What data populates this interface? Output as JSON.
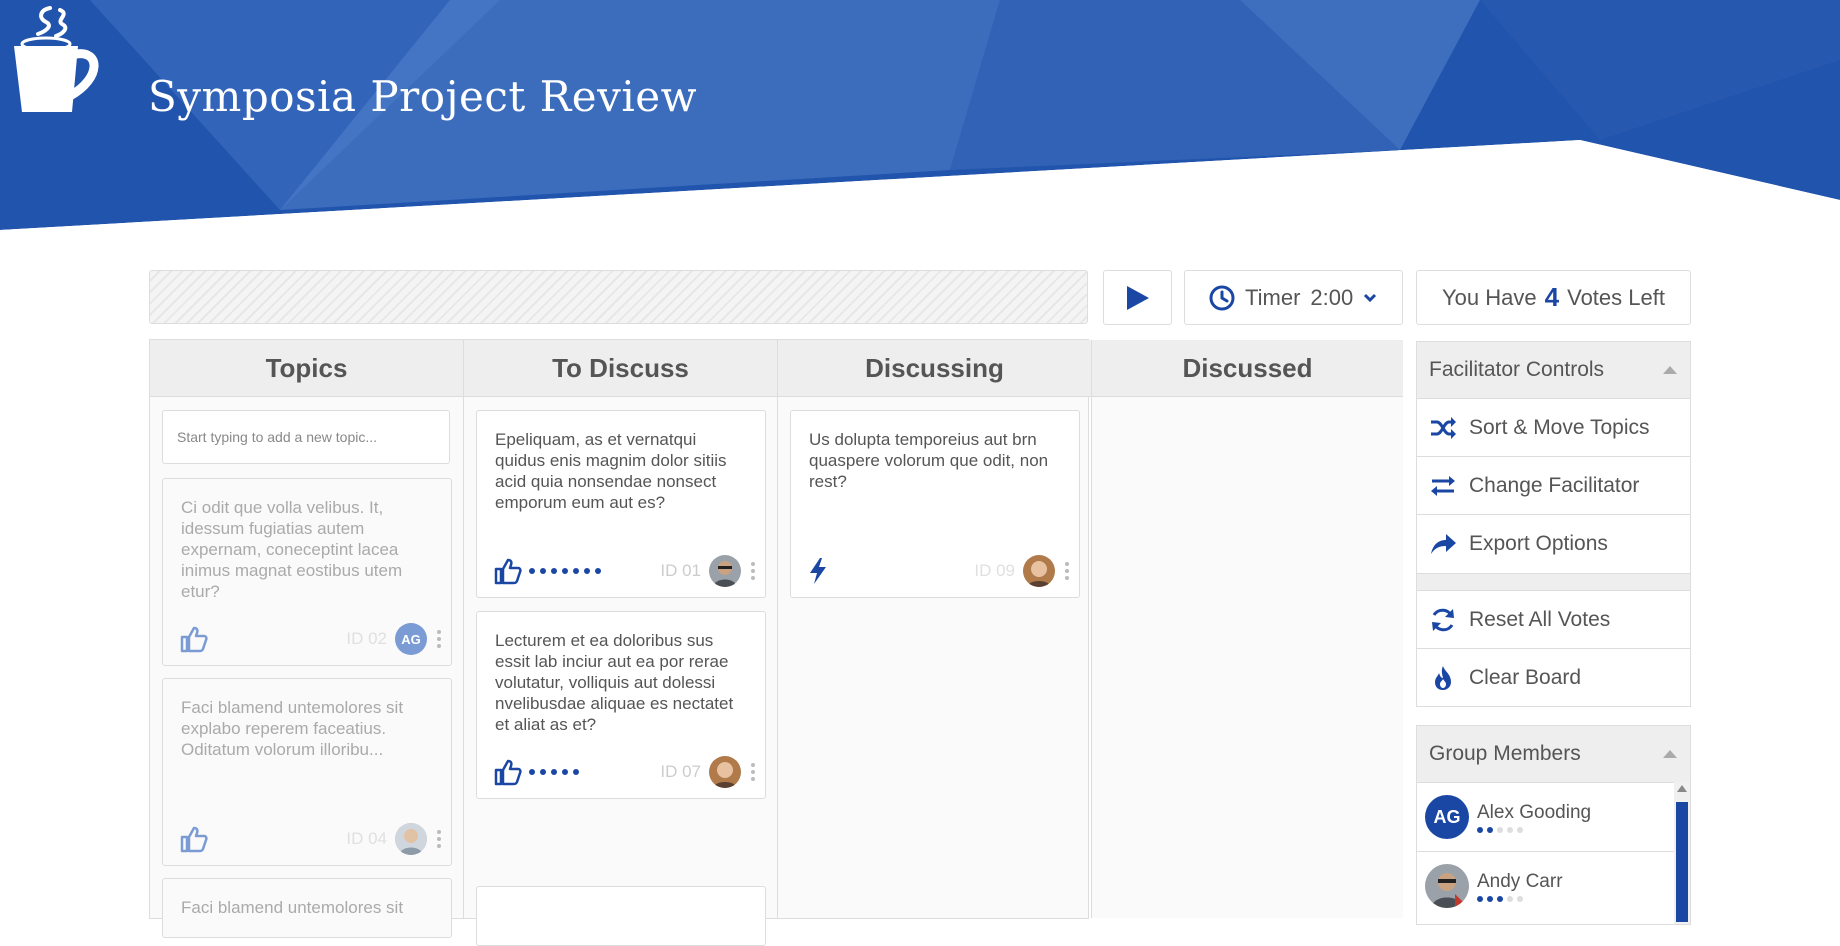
{
  "header": {
    "title": "Symposia Project Review",
    "logo_icon": "coffee-cup-icon",
    "bg_color": "#2154ac"
  },
  "toolbar": {
    "play_icon": "play-icon",
    "timer_label": "Timer",
    "timer_value": "2:00",
    "votes_prefix": "You Have",
    "votes_count": "4",
    "votes_suffix": "Votes Left"
  },
  "board": {
    "columns": [
      "Topics",
      "To Discuss",
      "Discussing",
      "Discussed"
    ],
    "new_topic_placeholder": "Start typing to add a new topic...",
    "topics": [
      {
        "text": "Ci odit que volla velibus. It, idessum fugiatias autem expernam, coneceptint lacea inimus magnat eostibus utem etur?",
        "id": "ID 02",
        "avatar": "AG"
      },
      {
        "text": "Faci blamend untemolores sit explabo reperem faceatius. Oditatum volorum illoribu...",
        "id": "ID 04",
        "avatar": ""
      },
      {
        "text": "Faci blamend untemolores sit"
      }
    ],
    "to_discuss": [
      {
        "text": "Epeliquam, as et vernatqui quidus enis magnim dolor sitiis acid quia nonsendae nonsect emporum eum aut es?",
        "id": "ID 01",
        "votes": 7
      },
      {
        "text": "Lecturem et ea doloribus sus essit lab inciur aut ea por rerae volutatur, volliquis aut dolessi nvelibusdae aliquae es nectatet et aliat as et?",
        "id": "ID 07",
        "votes": 5
      }
    ],
    "discussing": [
      {
        "text": "Us dolupta temporeius aut brn quaspere volorum que odit, non rest?",
        "id": "ID 09",
        "icon": "lightning-icon"
      }
    ]
  },
  "facilitator": {
    "title": "Facilitator Controls",
    "items": [
      {
        "label": "Sort & Move Topics",
        "icon": "shuffle-icon"
      },
      {
        "label": "Change Facilitator",
        "icon": "swap-icon"
      },
      {
        "label": "Export Options",
        "icon": "share-icon"
      }
    ],
    "items2": [
      {
        "label": "Reset All Votes",
        "icon": "refresh-icon"
      },
      {
        "label": "Clear Board",
        "icon": "fire-icon"
      }
    ]
  },
  "members": {
    "title": "Group Members",
    "list": [
      {
        "name": "Alex Gooding",
        "initials": "AG",
        "votes_used": 2,
        "votes_total": 5
      },
      {
        "name": "Andy Carr",
        "initials": "",
        "votes_used": 3,
        "votes_total": 5
      }
    ]
  },
  "colors": {
    "accent": "#1a47a4",
    "muted": "#aaa",
    "border": "#ddd"
  }
}
